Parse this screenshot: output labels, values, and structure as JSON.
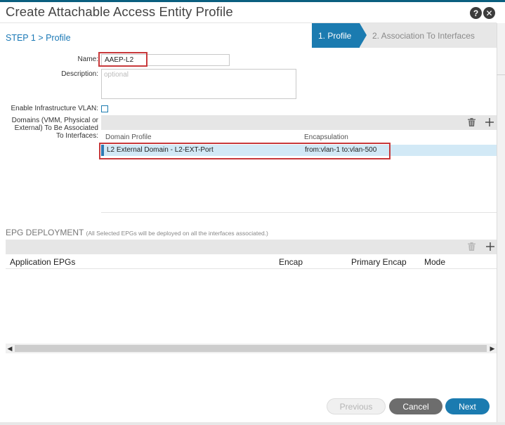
{
  "dialog": {
    "title": "Create Attachable Access Entity Profile",
    "help_glyph": "?",
    "close_glyph": "✕"
  },
  "step_label": "STEP 1 > Profile",
  "wizard": {
    "steps": [
      {
        "label": "1. Profile",
        "active": true
      },
      {
        "label": "2. Association To Interfaces",
        "active": false
      }
    ]
  },
  "form": {
    "name_label": "Name:",
    "name_value": "AAEP-L2",
    "description_label": "Description:",
    "description_placeholder": "optional",
    "infra_vlan_label": "Enable Infrastructure VLAN:",
    "infra_vlan_checked": false,
    "domains_label_lines": [
      "Domains (VMM, Physical or",
      "External) To Be Associated",
      "To Interfaces:"
    ]
  },
  "domains_table": {
    "columns": [
      "Domain Profile",
      "Encapsulation"
    ],
    "rows": [
      {
        "domain_profile": "L2 External Domain - L2-EXT-Port",
        "encapsulation": "from:vlan-1 to:vlan-500"
      }
    ],
    "icons": [
      "trash-icon",
      "plus-icon"
    ]
  },
  "epg_deployment": {
    "title": "EPG DEPLOYMENT",
    "note": "(All Selected EPGs will be deployed on all the interfaces associated.)",
    "columns": [
      "Application EPGs",
      "Encap",
      "Primary Encap",
      "Mode"
    ],
    "rows": []
  },
  "footer": {
    "previous_label": "Previous",
    "cancel_label": "Cancel",
    "next_label": "Next"
  },
  "colors": {
    "accent": "#1b7bb0",
    "highlight": "#c8393b",
    "selected_row": "#d2e9f6"
  }
}
